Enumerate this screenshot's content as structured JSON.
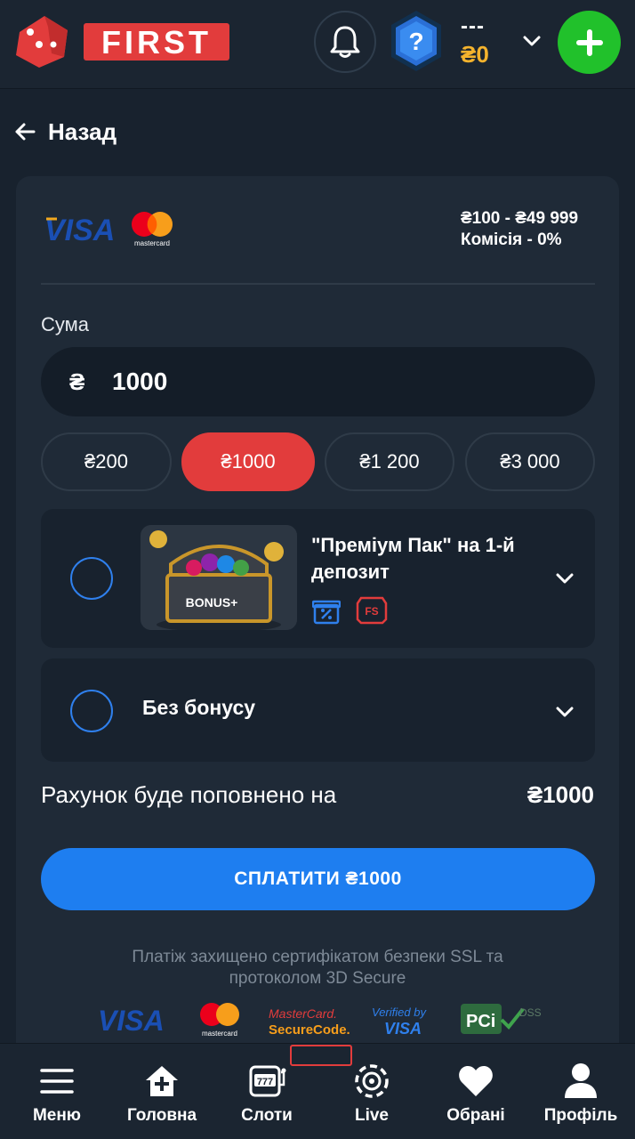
{
  "header": {
    "logo_text": "FIRST",
    "balance_name": "---",
    "balance_amount": "₴0",
    "colors": {
      "accent_red": "#e23c3c",
      "add_green": "#21c12b",
      "balance_gold": "#f4b32d"
    }
  },
  "back": {
    "label": "Назад"
  },
  "payment": {
    "method_logos": [
      "VISA",
      "mastercard"
    ],
    "limits": "₴100 - ₴49 999",
    "commission": "Комісія - 0%"
  },
  "amount": {
    "label": "Сума",
    "currency": "₴",
    "value": "1000",
    "presets": [
      {
        "label": "₴200",
        "active": false
      },
      {
        "label": "₴1000",
        "active": true
      },
      {
        "label": "₴1 200",
        "active": false
      },
      {
        "label": "₴3 000",
        "active": false
      }
    ]
  },
  "bonuses": [
    {
      "title": "\"Преміум Пак\" на 1-й депозит",
      "image_text": "BONUS+",
      "tags": [
        "percent-icon",
        "FS"
      ]
    },
    {
      "title": "Без бонусу"
    }
  ],
  "summary": {
    "label": "Рахунок буде поповнено на",
    "value": "₴1000"
  },
  "pay_button": {
    "label": "СПЛАТИТИ ₴1000",
    "color": "#1e7ef0"
  },
  "security": {
    "text": "Платіж захищено сертифікатом безпеки SSL та протоколом 3D Secure",
    "logos": {
      "visa": "VISA",
      "mastercard": "mastercard",
      "mc_secure_1": "MasterCard.",
      "mc_secure_2": "SecureCode.",
      "verified_1": "Verified by",
      "verified_2": "VISA",
      "pci": "PCi",
      "dss": "DSS"
    }
  },
  "bottom_nav": [
    {
      "label": "Меню",
      "icon": "menu-icon"
    },
    {
      "label": "Головна",
      "icon": "home-icon"
    },
    {
      "label": "Слоти",
      "icon": "slot-machine-icon"
    },
    {
      "label": "Live",
      "icon": "live-chip-icon"
    },
    {
      "label": "Обрані",
      "icon": "heart-icon"
    },
    {
      "label": "Профіль",
      "icon": "profile-icon"
    }
  ]
}
